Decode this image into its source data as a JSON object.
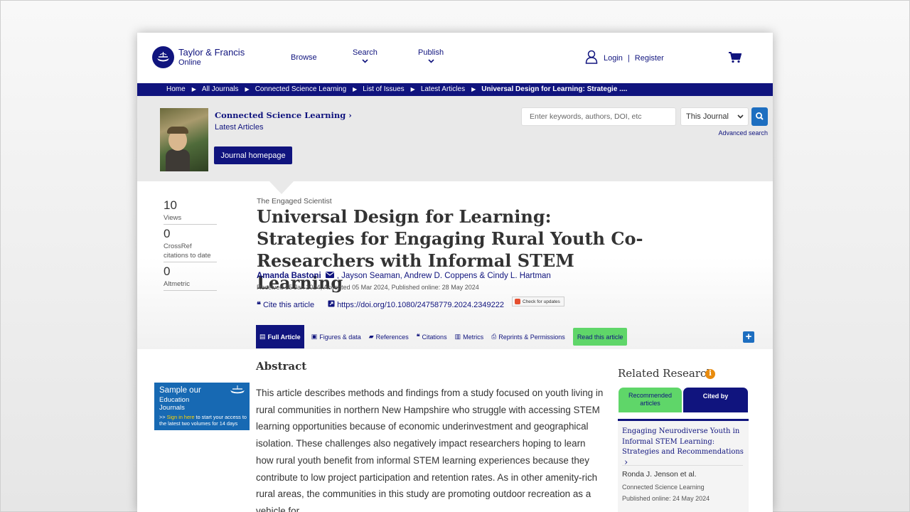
{
  "header": {
    "logo_name": "Taylor & Francis",
    "logo_sub": "Online",
    "nav": {
      "browse": "Browse",
      "search": "Search",
      "publish": "Publish"
    },
    "login": "Login",
    "separator": "|",
    "register": "Register"
  },
  "breadcrumb": {
    "items": [
      "Home",
      "All Journals",
      "Connected Science Learning",
      "List of Issues",
      "Latest Articles"
    ],
    "current": "Universal Design for Learning: Strategie ....",
    "separator": "▶"
  },
  "journal": {
    "title": "Connected Science Learning",
    "title_chevron": "›",
    "latest": "Latest Articles",
    "homepage_button": "Journal homepage"
  },
  "search": {
    "placeholder": "Enter keywords, authors, DOI, etc",
    "scope": "This Journal",
    "advanced": "Advanced search"
  },
  "metrics": [
    {
      "value": "10",
      "label": "Views"
    },
    {
      "value": "0",
      "label": "CrossRef citations to date"
    },
    {
      "value": "0",
      "label": "Altmetric"
    }
  ],
  "article": {
    "section": "The Engaged Scientist",
    "title": "Universal Design for Learning: Strategies for Engaging Rural Youth Co-Researchers with Informal STEM Learning",
    "first_author": "Amanda Bastoni",
    "other_authors": ", Jayson Seaman, Andrew D. Coppens & Cindy L. Hartman",
    "history": "Received 15 Jan 2024, Accepted 05 Mar 2024, Published online: 28 May 2024",
    "cite": "Cite this article",
    "doi": "https://doi.org/10.1080/24758779.2024.2349222",
    "check_updates": "Check for updates"
  },
  "tabs": {
    "full": "Full Article",
    "figures": "Figures & data",
    "references": "References",
    "citations": "Citations",
    "metrics": "Metrics",
    "reprints": "Reprints & Permissions",
    "read": "Read this article",
    "plus": "+"
  },
  "abstract": {
    "heading": "Abstract",
    "text": "This article describes methods and findings from a study focused on youth living in rural communities in northern New Hampshire who struggle with accessing STEM learning opportunities because of economic underinvestment and geographical isolation. These challenges also negatively impact researchers hoping to learn how rural youth benefit from informal STEM learning experiences because they contribute to low project participation and retention rates. As in other amenity-rich rural areas, the communities in this study are promoting outdoor recreation as a vehicle for"
  },
  "ad": {
    "line1": "Sample our",
    "line2a": "Education",
    "line2b": "Journals",
    "arrows": ">> ",
    "sign_in": "Sign in here",
    "rest": " to start your access to the latest two volumes for 14 days"
  },
  "related": {
    "title": "Related Research",
    "info": "i",
    "tab_recommended": "Recommended articles",
    "tab_cited": "Cited by",
    "item": {
      "title": "Engaging Neurodiverse Youth in Informal STEM Learning: Strategies and Recommendations",
      "chevron": "›",
      "authors": "Ronda J. Jenson et al.",
      "journal": "Connected Science Learning",
      "published": "Published online: 24 May 2024"
    }
  },
  "colors": {
    "navy": "#10147e",
    "link_blue": "#1d6ec0",
    "green": "#5fd669",
    "orange": "#e88b0e"
  }
}
